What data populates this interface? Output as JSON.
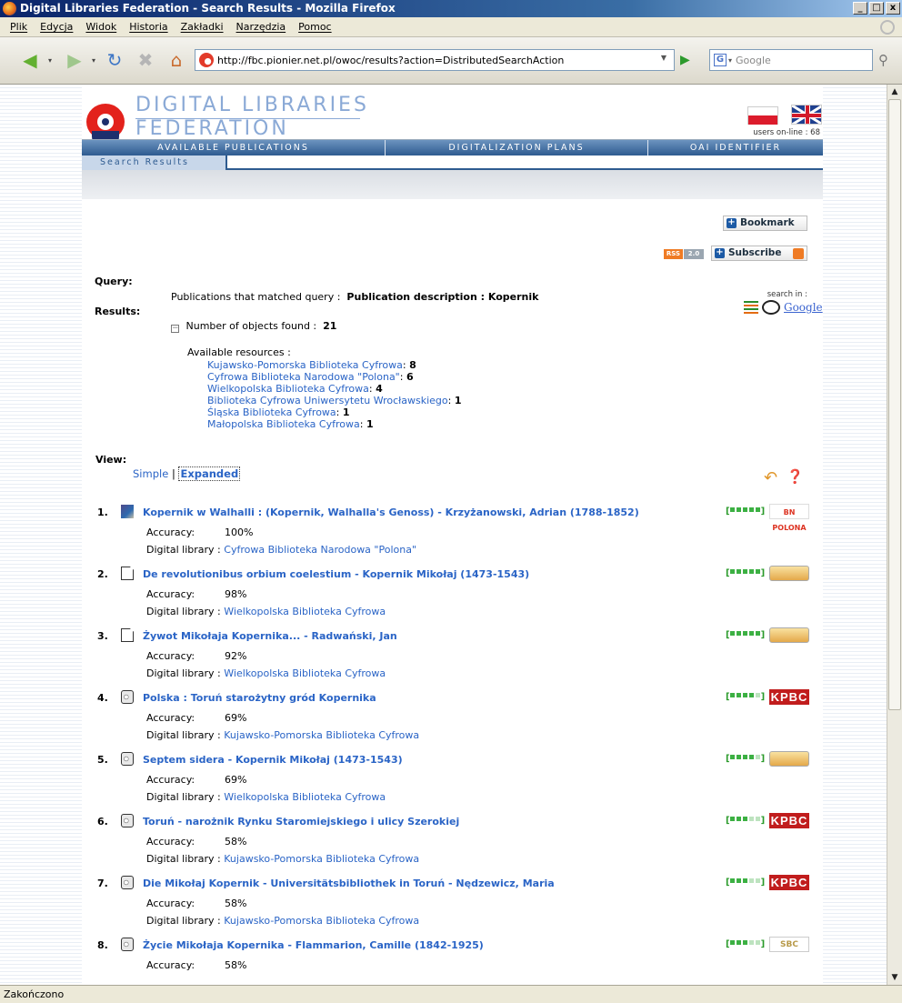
{
  "window": {
    "title": "Digital Libraries Federation - Search Results - Mozilla Firefox"
  },
  "menu": [
    "Plik",
    "Edycja",
    "Widok",
    "Historia",
    "Zakładki",
    "Narzędzia",
    "Pomoc"
  ],
  "toolbar": {
    "url": "http://fbc.pionier.net.pl/owoc/results?action=DistributedSearchAction",
    "search_placeholder": "Google"
  },
  "header": {
    "title_line1": "DIGITAL LIBRARIES",
    "title_line2": "FEDERATION",
    "users_online": "users on-line : 68",
    "nav": [
      "AVAILABLE PUBLICATIONS",
      "DIGITALIZATION PLANS",
      "OAI IDENTIFIER"
    ],
    "subtab": "Search Results"
  },
  "actions": {
    "bookmark": "Bookmark",
    "rss": "RSS",
    "rss_ver": "2.0",
    "subscribe": "Subscribe"
  },
  "query": {
    "label": "Query:",
    "results_label": "Results:",
    "prefix": "Publications that matched query :",
    "text": "Publication description : Kopernik",
    "search_in": "search in :",
    "search_google": "Google",
    "found_label": "Number of objects found :",
    "found_count": "21",
    "available": "Available resources :",
    "resources": [
      {
        "name": "Kujawsko-Pomorska Biblioteka Cyfrowa",
        "count": "8"
      },
      {
        "name": "Cyfrowa Biblioteka Narodowa \"Polona\"",
        "count": "6"
      },
      {
        "name": "Wielkopolska Biblioteka Cyfrowa",
        "count": "4"
      },
      {
        "name": "Biblioteka Cyfrowa Uniwersytetu Wrocławskiego",
        "count": "1"
      },
      {
        "name": "Śląska Biblioteka Cyfrowa",
        "count": "1"
      },
      {
        "name": "Małopolska Biblioteka Cyfrowa",
        "count": "1"
      }
    ]
  },
  "view": {
    "label": "View:",
    "simple": "Simple",
    "sep": "|",
    "expanded": "Expanded"
  },
  "results": [
    {
      "num": "1.",
      "icon": "image",
      "title": "Kopernik w Walhalli : (Kopernik, Walhalla's Genoss) - Krzyżanowski, Adrian (1788-1852)",
      "accuracy": "100%",
      "library": "Cyfrowa Biblioteka Narodowa \"Polona\"",
      "level": 5,
      "badge": "polona",
      "badge_text": "BN POLONA"
    },
    {
      "num": "2.",
      "icon": "document",
      "title": "De revolutionibus orbium coelestium - Kopernik Mikołaj (1473-1543)",
      "accuracy": "98%",
      "library": "Wielkopolska Biblioteka Cyfrowa",
      "level": 5,
      "badge": "hand",
      "badge_text": ""
    },
    {
      "num": "3.",
      "icon": "document",
      "title": "Żywot Mikołaja Kopernika... - Radwański, Jan",
      "accuracy": "92%",
      "library": "Wielkopolska Biblioteka Cyfrowa",
      "level": 5,
      "badge": "hand",
      "badge_text": ""
    },
    {
      "num": "4.",
      "icon": "volume",
      "title": "Polska : Toruń starożytny gród Kopernika",
      "accuracy": "69%",
      "library": "Kujawsko-Pomorska Biblioteka Cyfrowa",
      "level": 4,
      "badge": "kpbc",
      "badge_text": "KPBC"
    },
    {
      "num": "5.",
      "icon": "volume",
      "title": "Septem sidera - Kopernik Mikołaj (1473-1543)",
      "accuracy": "69%",
      "library": "Wielkopolska Biblioteka Cyfrowa",
      "level": 4,
      "badge": "hand",
      "badge_text": ""
    },
    {
      "num": "6.",
      "icon": "volume",
      "title": "Toruń - narożnik Rynku Staromiejskiego i ulicy Szerokiej",
      "accuracy": "58%",
      "library": "Kujawsko-Pomorska Biblioteka Cyfrowa",
      "level": 3,
      "badge": "kpbc",
      "badge_text": "KPBC"
    },
    {
      "num": "7.",
      "icon": "volume",
      "title": "Die Mikołaj Kopernik - Universitätsbibliothek in Toruń - Nędzewicz, Maria",
      "accuracy": "58%",
      "library": "Kujawsko-Pomorska Biblioteka Cyfrowa",
      "level": 3,
      "badge": "kpbc",
      "badge_text": "KPBC"
    },
    {
      "num": "8.",
      "icon": "volume",
      "title": "Życie Mikołaja Kopernika - Flammarion, Camille (1842-1925)",
      "accuracy": "58%",
      "library": "",
      "level": 3,
      "badge": "sbc",
      "badge_text": "SBC"
    }
  ],
  "labels": {
    "accuracy": "Accuracy:",
    "library": "Digital library :"
  },
  "status": "Zakończono"
}
